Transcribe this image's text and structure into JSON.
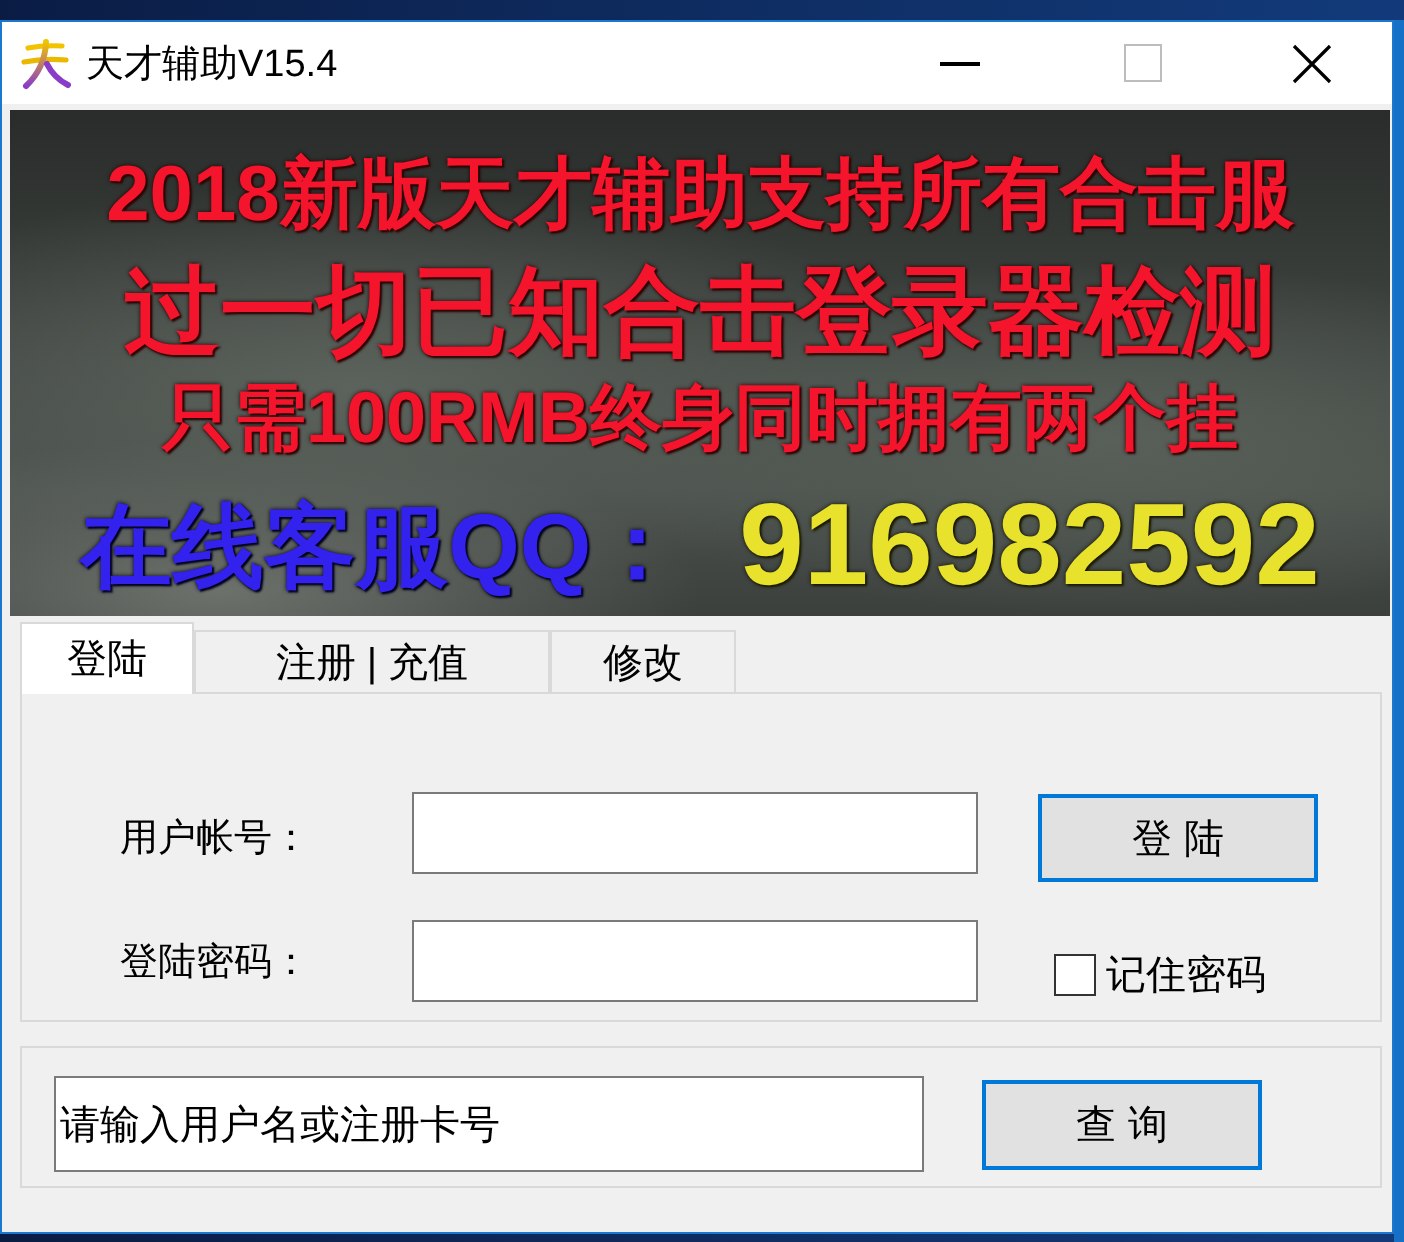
{
  "window": {
    "title": "天才辅助V15.4",
    "maximize_disabled": true
  },
  "banner": {
    "headlines": [
      "2018新版天才辅助支持所有合击服",
      "过一切已知合击登录器检测",
      "只需100RMB终身同时拥有两个挂"
    ],
    "contact_label": "在线客服QQ：",
    "contact_number": "916982592"
  },
  "tabs": [
    {
      "label": "登陆",
      "selected": true
    },
    {
      "label": "注册 | 充值",
      "selected": false
    },
    {
      "label": "修改",
      "selected": false
    }
  ],
  "login_form": {
    "fields": [
      {
        "label": "用户帐号："
      },
      {
        "label": "登陆密码："
      }
    ],
    "login_button": "登 陆",
    "remember_password": {
      "label": "记住密码",
      "checked": false
    }
  },
  "query_form": {
    "value": "请输入用户名或注册卡号",
    "query_button": "查 询"
  }
}
